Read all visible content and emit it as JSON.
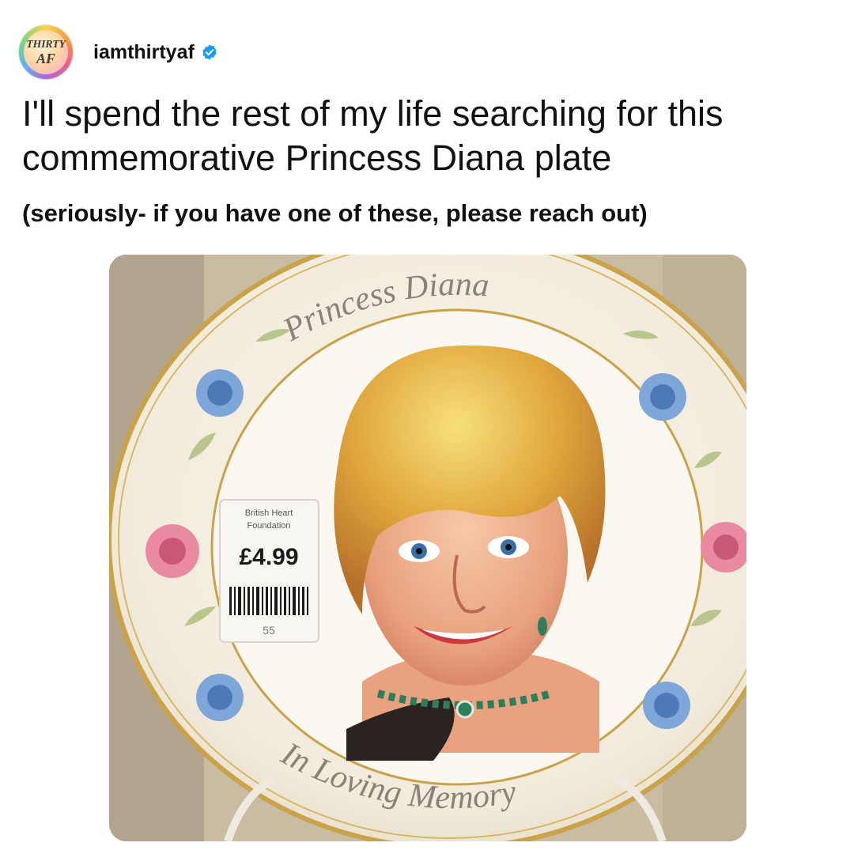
{
  "post": {
    "avatar_text_top": "THIRTY",
    "avatar_text_bottom": "AF",
    "username": "iamthirtyaf",
    "text": "I'll spend the rest of my life searching for this commemorative Princess Diana plate",
    "subtext": "(seriously- if you have one of these, please reach out)"
  },
  "photo": {
    "plate_top_text": "Princess Diana",
    "plate_bottom_text": "In Loving Memory",
    "sticker_org_line1": "British Heart",
    "sticker_org_line2": "Foundation",
    "sticker_price": "£4.99",
    "sticker_code": "55"
  },
  "icons": {
    "verified": "verified-badge-icon"
  },
  "colors": {
    "verified_blue": "#1d9bf0",
    "text": "#111111",
    "plate_gold": "#c9a24a"
  }
}
